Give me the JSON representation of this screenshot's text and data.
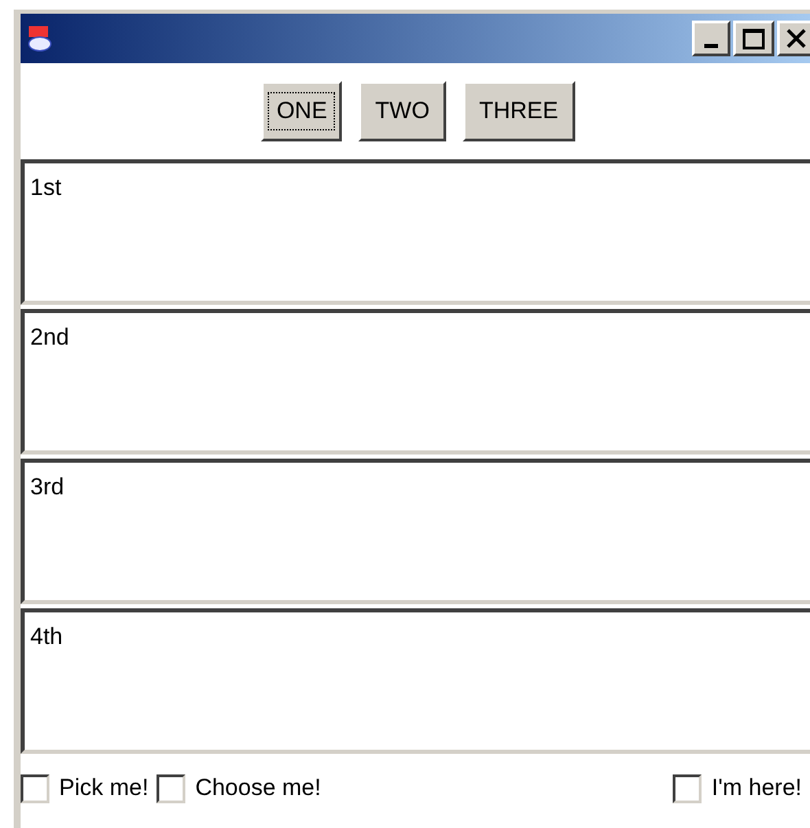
{
  "buttons": [
    {
      "label": "ONE",
      "focused": true
    },
    {
      "label": "TWO",
      "focused": false
    },
    {
      "label": "THREE",
      "focused": false
    }
  ],
  "text_areas": [
    {
      "value": "1st"
    },
    {
      "value": "2nd"
    },
    {
      "value": "3rd"
    },
    {
      "value": "4th"
    }
  ],
  "checkboxes": [
    {
      "label": "Pick me!",
      "checked": false
    },
    {
      "label": "Choose me!",
      "checked": false
    },
    {
      "label": "I'm here!",
      "checked": false
    }
  ]
}
